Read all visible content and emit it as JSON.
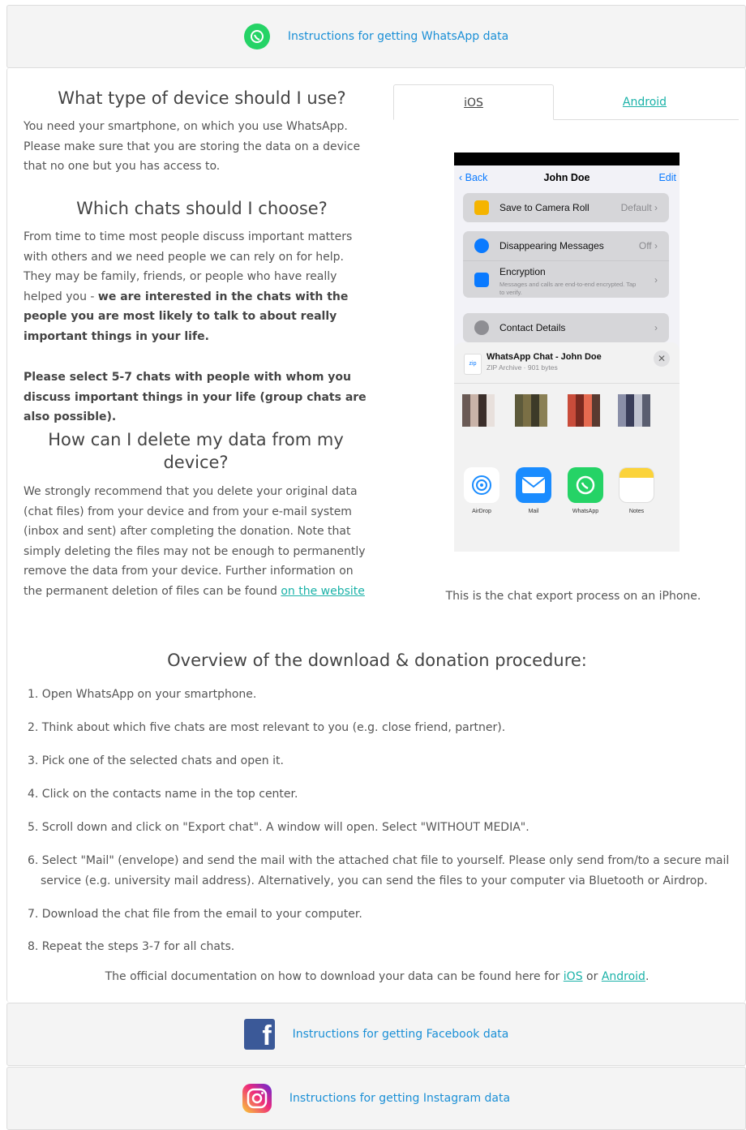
{
  "whatsapp_header": {
    "label": "Instructions for getting WhatsApp data"
  },
  "facebook_header": {
    "label": "Instructions for getting Facebook data"
  },
  "instagram_header": {
    "label": "Instructions for getting Instagram data"
  },
  "device_section": {
    "heading": "What type of device should I use?",
    "text": "You need your smartphone, on which you use WhatsApp. Please make sure that you are storing the data on a device that no one but you has access to."
  },
  "chats_section": {
    "heading": "Which chats should I choose?",
    "text_intro": "From time to time most people discuss important matters with others and we need people we can rely on for help. They may be family, friends, or people who have really helped you - ",
    "text_bold": "we are interested in the chats with the people you are most likely to talk to about really important things in your life.",
    "select_note": "Please select 5-7 chats with people with whom you discuss important things in your life (group chats are also possible)."
  },
  "delete_section": {
    "heading": "How can I delete my data from my device?",
    "text": "We strongly recommend that you delete your original data (chat files) from your device and from your e-mail system (inbox and sent) after completing the donation. Note that simply deleting the files may not be enough to permanently remove the data from your device. Further information on the permanent deletion of files can be found ",
    "link": "on the website"
  },
  "tabs": {
    "ios": "iOS",
    "android": "Android"
  },
  "phone": {
    "back": "Back",
    "contact": "John Doe",
    "edit": "Edit",
    "save_camera_roll": "Save to Camera Roll",
    "save_value": "Default",
    "disappearing": "Disappearing Messages",
    "disappearing_value": "Off",
    "encryption": "Encryption",
    "encryption_sub": "Messages and calls are end-to-end encrypted. Tap to verify.",
    "contact_details": "Contact Details",
    "file_icon": "zip",
    "file_name": "WhatsApp Chat - John Doe",
    "file_sub": "ZIP Archive · 901 bytes",
    "close_glyph": "✕",
    "apps": [
      "AirDrop",
      "Mail",
      "WhatsApp",
      "Notes"
    ]
  },
  "caption": "This is the chat export process on an iPhone.",
  "overview": {
    "heading": "Overview of the download & donation procedure:",
    "steps": [
      "1. Open WhatsApp on your smartphone.",
      "2. Think about which five chats are most relevant to you (e.g. close friend, partner).",
      "3. Pick one of the selected chats and open it.",
      "4. Click on the contacts name in the top center.",
      "5. Scroll down and click on \"Export chat\". A window will open. Select \"WITHOUT MEDIA\".",
      "6. Select \"Mail\" (envelope) and send the mail with the attached chat file to yourself. Please only send from/to a secure mail service (e.g. university mail address). Alternatively, you can send the files to your computer via Bluetooth or Airdrop.",
      "7. Download the chat file from the email to your computer.",
      "8. Repeat the steps 3-7 for all chats."
    ],
    "official_text": "The official documentation on how to download your data can be found here for ",
    "official_ios": "iOS",
    "official_or": " or ",
    "official_android": "Android",
    "official_end": "."
  },
  "colors": {
    "link": "#1a8fd6",
    "teal": "#1ab2a8",
    "whatsapp": "#25d366",
    "facebook": "#3b5998"
  }
}
